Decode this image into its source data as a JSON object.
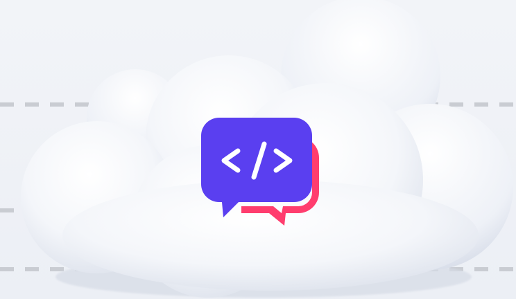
{
  "scene": {
    "background_color": "#eef1f6",
    "guide_dash_color": "#c9ccd2",
    "cloud_color": "#f7f8fb"
  },
  "logo": {
    "icon": "code-chat-bubbles-icon",
    "primary_color": "#5a3ff0",
    "secondary_color": "#ff3d6e",
    "glyph": "</>"
  }
}
